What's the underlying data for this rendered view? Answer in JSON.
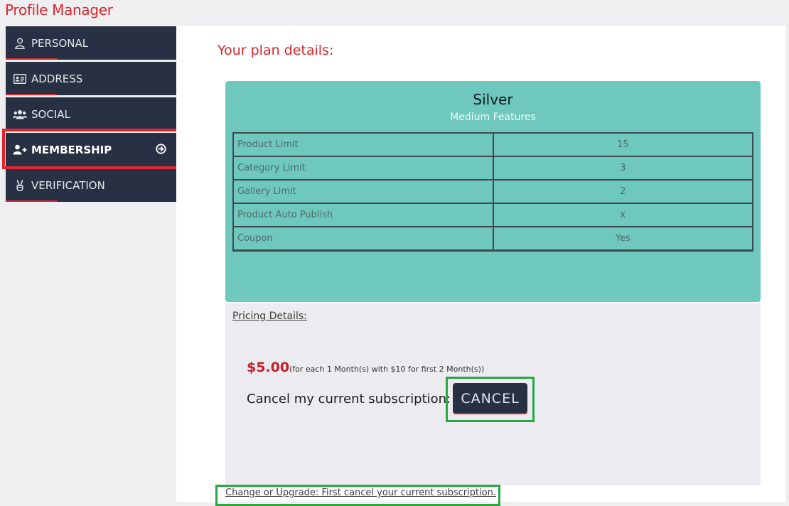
{
  "app": {
    "title": "Profile Manager"
  },
  "sidebar": {
    "items": [
      {
        "label": "PERSONAL",
        "icon": "user-icon"
      },
      {
        "label": "ADDRESS",
        "icon": "id-card-icon"
      },
      {
        "label": "SOCIAL",
        "icon": "users-icon"
      },
      {
        "label": "MEMBERSHIP",
        "icon": "user-plus-icon",
        "active": true
      },
      {
        "label": "VERIFICATION",
        "icon": "victory-hand-icon"
      }
    ]
  },
  "main": {
    "heading": "Your plan details:",
    "plan": {
      "name": "Silver",
      "subtitle": "Medium Features",
      "features": [
        {
          "name": "Product Limit",
          "value": "15"
        },
        {
          "name": "Category Limit",
          "value": "3"
        },
        {
          "name": "Gallery Limit",
          "value": "2"
        },
        {
          "name": "Product Auto Publish",
          "value": "x"
        },
        {
          "name": "Coupon",
          "value": "Yes"
        }
      ]
    },
    "pricing": {
      "title": "Pricing Details:",
      "price": "$5.00",
      "note": "(for each 1 Month(s) with $10 for first 2 Month(s))",
      "cancel_label": "Cancel my current subscription:",
      "cancel_button": "CANCEL"
    },
    "upgrade_link": "Change or Upgrade: First cancel your current subscription."
  },
  "colors": {
    "accent_red": "#d9262b",
    "nav_bg": "#273143",
    "plan_card": "#6ec8bd",
    "highlight_red": "#e3232e",
    "highlight_green": "#27a844"
  }
}
